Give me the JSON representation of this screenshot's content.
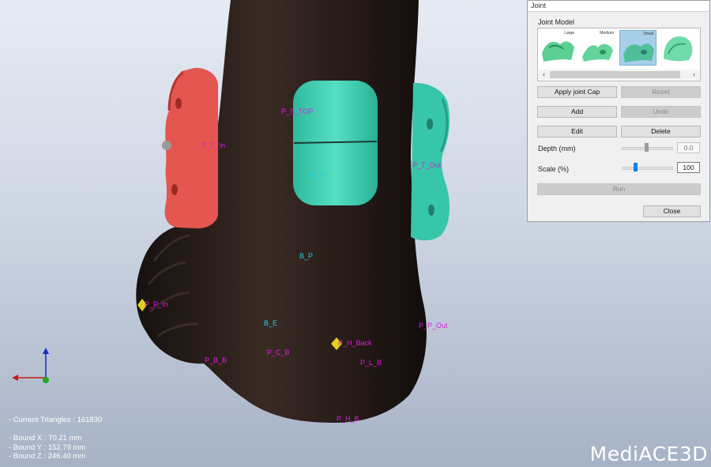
{
  "viewport": {
    "labels": {
      "p_s_top": "P_S_TOP",
      "p_t_in": "P_T_In",
      "b_s": "B_S",
      "p_t_out": "P_T_Out",
      "b_p": "B_P",
      "p_p_in": "P_P_In",
      "b_e": "B_E",
      "p_h_back": "P_H_Back",
      "p_p_out": "P_P_Out",
      "p_b_b": "P_B_B",
      "p_c_b": "P_C_B",
      "p_l_b": "P_L_B",
      "p_h_b": "P_H_B"
    },
    "info": {
      "triangles": "- Current Triangles : 161830",
      "bound_x": "- Bound X : 70.21 mm",
      "bound_y": "- Bound Y : 152.79 mm",
      "bound_z": "- Bound Z : 246.40 mm"
    },
    "logo": "MediACE3D",
    "colors": {
      "model_skin": "#2b211d",
      "lateral_joint": "#e4564f",
      "medial_joint": "#37c6a9",
      "front_cap": "#48d6b8",
      "marker": "#e3d01c"
    }
  },
  "panel": {
    "title": "Joint",
    "joint_model_label": "Joint Model",
    "thumbnails": [
      {
        "caption": "Large",
        "selected": false
      },
      {
        "caption": "Medium",
        "selected": false
      },
      {
        "caption": "Small",
        "selected": true
      },
      {
        "caption": "",
        "selected": false
      }
    ],
    "scroll_left": "‹",
    "scroll_right": "›",
    "buttons": {
      "apply": "Apply joint Cap",
      "reset": "Reset",
      "add": "Add",
      "undo": "Undo",
      "edit": "Edit",
      "delete": "Delete",
      "run": "Run",
      "close": "Close"
    },
    "depth": {
      "label": "Depth (mm)",
      "value": "0.0",
      "slider_fraction": 0.5
    },
    "scale": {
      "label": "Scale (%)",
      "value": "100",
      "slider_fraction": 0.27
    }
  }
}
